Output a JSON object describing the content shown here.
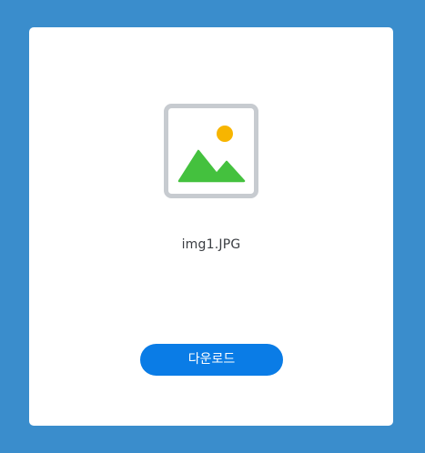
{
  "file": {
    "name": "img1.JPG",
    "icon": "image-file-icon"
  },
  "actions": {
    "download_label": "다운로드"
  },
  "colors": {
    "background": "#3a8dcc",
    "card": "#ffffff",
    "button": "#0a7ce6",
    "icon_frame": "#c7cbd0",
    "icon_mountain": "#44c13e",
    "icon_sun": "#f7b500"
  }
}
